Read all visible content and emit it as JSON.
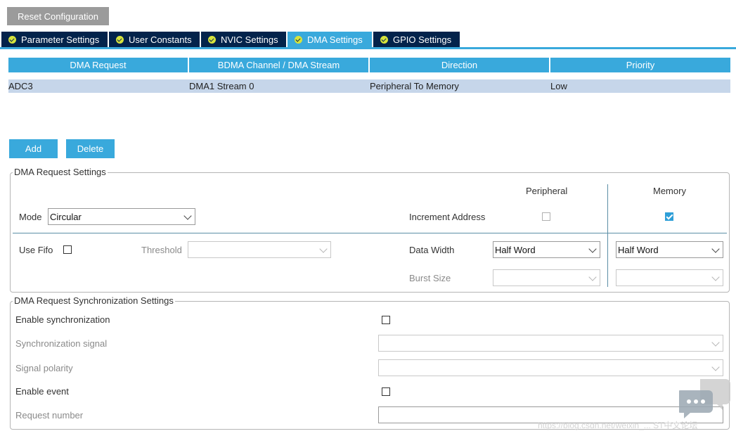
{
  "reset_label": "Reset Configuration",
  "tabs": [
    {
      "label": "Parameter Settings"
    },
    {
      "label": "User Constants"
    },
    {
      "label": "NVIC Settings"
    },
    {
      "label": "DMA Settings"
    },
    {
      "label": "GPIO Settings"
    }
  ],
  "table": {
    "headers": [
      "DMA Request",
      "BDMA Channel / DMA Stream",
      "Direction",
      "Priority"
    ],
    "rows": [
      [
        "ADC3",
        "DMA1 Stream 0",
        "Peripheral To Memory",
        "Low"
      ]
    ]
  },
  "buttons": {
    "add": "Add",
    "delete": "Delete"
  },
  "request_settings": {
    "legend": "DMA Request Settings",
    "peripheral_header": "Peripheral",
    "memory_header": "Memory",
    "mode_label": "Mode",
    "mode_value": "Circular",
    "increment_label": "Increment Address",
    "use_fifo_label": "Use Fifo",
    "threshold_label": "Threshold",
    "threshold_value": "",
    "data_width_label": "Data Width",
    "peripheral_data_width": "Half Word",
    "memory_data_width": "Half Word",
    "burst_size_label": "Burst Size",
    "peripheral_burst": "",
    "memory_burst": ""
  },
  "sync_settings": {
    "legend": "DMA Request Synchronization Settings",
    "enable_sync_label": "Enable synchronization",
    "sync_signal_label": "Synchronization signal",
    "sync_signal_value": "",
    "signal_polarity_label": "Signal polarity",
    "signal_polarity_value": "",
    "enable_event_label": "Enable event",
    "request_number_label": "Request number",
    "request_number_value": ""
  },
  "watermark": "https://blog.csdn.net/weixin_... ST中文论坛",
  "colors": {
    "tab_dark": "#03234b",
    "accent": "#39a9dc",
    "row_selected": "#c6d6ea",
    "check_ok": "#d6e33c"
  }
}
